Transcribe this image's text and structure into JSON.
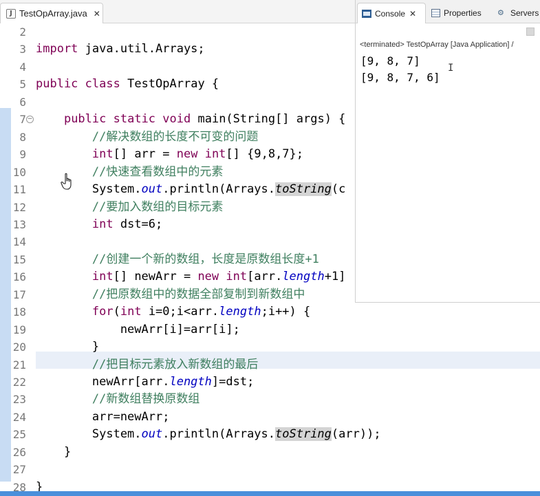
{
  "editor": {
    "tab_label": "TestOpArray.java",
    "tab_close": "✕",
    "file_icon_letter": "J",
    "lines": [
      {
        "n": "2"
      },
      {
        "n": "3",
        "p": [
          "kw:import",
          " java.util.Arrays;"
        ]
      },
      {
        "n": "4"
      },
      {
        "n": "5",
        "p": [
          "kw:public",
          " ",
          "kw:class",
          " TestOpArray {"
        ]
      },
      {
        "n": "6"
      },
      {
        "n": "7",
        "fold": true,
        "p": [
          "    ",
          "kw:public",
          " ",
          "kw:static",
          " ",
          "kw:void",
          " main(String[] args) {"
        ]
      },
      {
        "n": "8",
        "p": [
          "        ",
          "cm://解决数组的长度不可变的问题"
        ]
      },
      {
        "n": "9",
        "p": [
          "        ",
          "kw:int",
          "[] arr = ",
          "kw:new",
          " ",
          "kw:int",
          "[] {9,8,7};"
        ]
      },
      {
        "n": "10",
        "p": [
          "        ",
          "cm://快速查看数组中的元素"
        ]
      },
      {
        "n": "11",
        "p": [
          "        System.",
          "fld:out",
          ".println(Arrays.",
          "sel:toString",
          "(c"
        ]
      },
      {
        "n": "12",
        "p": [
          "        ",
          "cm://要加入数组的目标元素"
        ]
      },
      {
        "n": "13",
        "p": [
          "        ",
          "kw:int",
          " dst=6;"
        ]
      },
      {
        "n": "14"
      },
      {
        "n": "15",
        "p": [
          "        ",
          "cm://创建一个新的数组，长度是原数组长度+1"
        ]
      },
      {
        "n": "16",
        "p": [
          "        ",
          "kw:int",
          "[] newArr = ",
          "kw:new",
          " ",
          "kw:int",
          "[arr.",
          "fld:length",
          "+1]"
        ]
      },
      {
        "n": "17",
        "p": [
          "        ",
          "cm://把原数组中的数据全部复制到新数组中"
        ]
      },
      {
        "n": "18",
        "p": [
          "        ",
          "kw:for",
          "(",
          "kw:int",
          " i=0;i<arr.",
          "fld:length",
          ";i++) {"
        ]
      },
      {
        "n": "19",
        "p": [
          "            newArr[i]=arr[i];"
        ]
      },
      {
        "n": "20",
        "p": [
          "        }"
        ]
      },
      {
        "n": "21",
        "p": [
          "        ",
          "cm://把目标元素放入新数组的最后"
        ]
      },
      {
        "n": "22",
        "p": [
          "        newArr[arr.",
          "fld:length",
          "]=dst;"
        ]
      },
      {
        "n": "23",
        "p": [
          "        ",
          "cm://新数组替换原数组"
        ]
      },
      {
        "n": "24",
        "p": [
          "        arr=newArr;"
        ]
      },
      {
        "n": "25",
        "p": [
          "        System.",
          "fld:out",
          ".println(Arrays.",
          "sel:toString",
          "(arr));"
        ]
      },
      {
        "n": "26",
        "p": [
          "    }"
        ]
      },
      {
        "n": "27"
      },
      {
        "n": "28",
        "p": [
          "}"
        ]
      }
    ]
  },
  "console": {
    "tabs": [
      {
        "label": "Console",
        "close": "✕"
      },
      {
        "label": "Properties"
      },
      {
        "label": "Servers"
      }
    ],
    "status": "<terminated> TestOpArray [Java Application] /",
    "output": [
      "[9, 8, 7]",
      "[9, 8, 7, 6]"
    ],
    "caret": "I"
  },
  "colors": {
    "keyword": "#7f0055",
    "comment": "#3f7f5f",
    "field": "#0000c0",
    "gutter_bar": "#c8dcf3",
    "line_highlight": "#e9eff8",
    "bottom_strip": "#4a8fdb"
  },
  "icons": {
    "file": "java-file-icon",
    "console": "console-icon",
    "properties": "properties-icon",
    "servers": "servers-icon",
    "fold": "fold-collapse-icon",
    "pointer": "hand-pointer-icon"
  }
}
